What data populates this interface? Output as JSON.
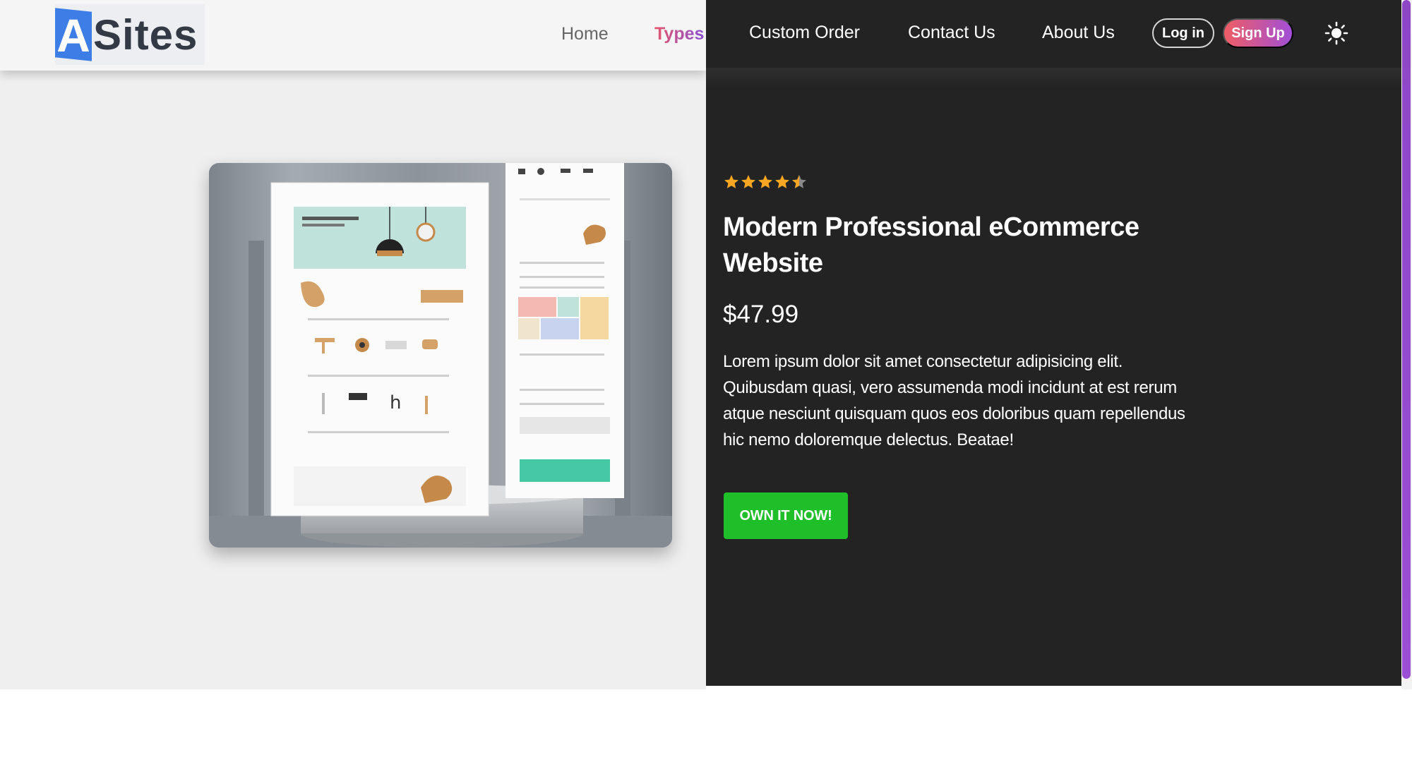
{
  "brand": {
    "logo_letter": "A",
    "logo_text": "Sites",
    "logo_color": "#3d7de6"
  },
  "nav": {
    "home": "Home",
    "types": "Types",
    "custom_order": "Custom Order",
    "contact_us": "Contact Us",
    "about_us": "About Us",
    "login": "Log in",
    "signup": "Sign Up",
    "theme_toggle_icon": "sun-icon"
  },
  "product": {
    "rating": 4.5,
    "rating_max": 5,
    "title": "Modern Professional eCommerce Website",
    "price": "$47.99",
    "description": "Lorem ipsum dolor sit amet consectetur adipisicing elit. Quibusdam quasi, vero assumenda modi incidunt at est rerum atque nesciunt quisquam quos eos doloribus quam repellendus hic nemo doloremque delectus. Beatae!",
    "cta": "OWN IT NOW!",
    "image_icon": "website-mockup-image"
  },
  "colors": {
    "accent_green": "#1fbf2a",
    "star": "#f5a623",
    "dark_bg": "#232323",
    "signup_gradient": [
      "#ef5d63",
      "#a24fd6"
    ],
    "scroll_thumb": "#9b4fd4"
  }
}
